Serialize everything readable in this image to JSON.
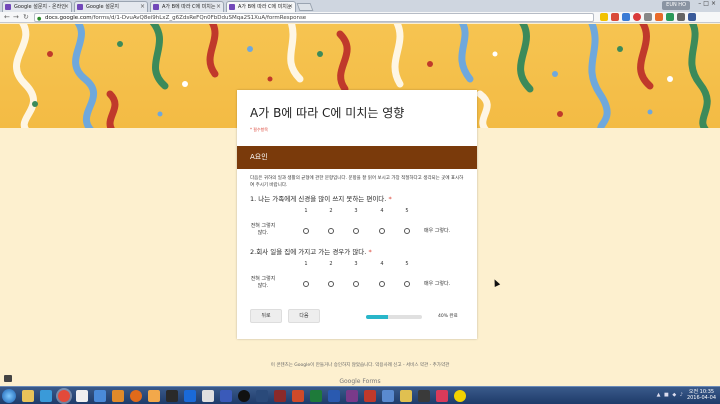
{
  "browser": {
    "tabs": [
      {
        "label": "Google 설문지 - 온라인",
        "active": false
      },
      {
        "label": "Google 설문지",
        "active": false
      },
      {
        "label": "A가 B에 따라 C에 미치는",
        "active": false
      },
      {
        "label": "A가 B에 따라 C에 미치는",
        "active": true
      }
    ],
    "user": "EUN HO",
    "url_host": "docs.google.com",
    "url_path": "/forms/d/1-DvuAvQ8ei9hLxZ_g6ZdsReFQn0FbDduSMqa2S1XuA/formResponse",
    "accent": "#7248b9"
  },
  "form": {
    "title": "A가 B에 따라 C에 미치는 영향",
    "required_note": "* 필수항목",
    "section_title": "A요인",
    "section_color": "#7a3a0b",
    "description": "다음은 귀하의 일과 생활의 균형에 관한 문항입니다. 문항을 잘 읽어 보시고 가장 적절하다고 생각되는 곳에 표시하여 주시기 바랍니다.",
    "questions": [
      {
        "title": "1. 나는 가족에게 신경을 많이 쓰지 못하는 편이다.",
        "required": "*",
        "scale": [
          "1",
          "2",
          "3",
          "4",
          "5"
        ],
        "left_label": "전혀 그렇지 않다.",
        "right_label": "매우 그렇다."
      },
      {
        "title": "2.회사 일을 집에 가지고 가는 경우가 많다.",
        "required": "*",
        "scale": [
          "1",
          "2",
          "3",
          "4",
          "5"
        ],
        "left_label": "전혀 그렇지 않다.",
        "right_label": "매우 그렇다."
      }
    ],
    "back_button": "뒤로",
    "next_button": "다음",
    "progress_percent": 40,
    "progress_label": "40% 완료",
    "progress_color": "#29b6c9"
  },
  "page_footer": "이 콘텐츠는 Google이 만들거나 승인하지 않았습니다. 악용사례 신고 - 서비스 약관 - 추가약관",
  "brand": "Google Forms",
  "taskbar": {
    "time": "오전 10:35",
    "date": "2016-04-04",
    "tray_icons": "▲ ■ ◆ ♪"
  }
}
